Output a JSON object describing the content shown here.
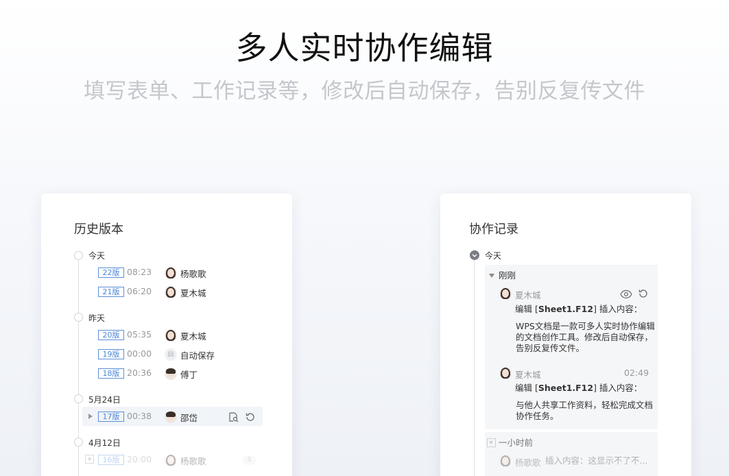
{
  "hero": {
    "title": "多人实时协作编辑",
    "subtitle": "填写表单、工作记录等，修改后自动保存，告别反复传文件"
  },
  "history": {
    "title": "历史版本",
    "days": [
      {
        "label": "今天",
        "entries": [
          {
            "version": "22版",
            "time": "08:23",
            "user": "杨歌歌",
            "avatar": "female"
          },
          {
            "version": "21版",
            "time": "06:20",
            "user": "夏木城",
            "avatar": "female"
          }
        ]
      },
      {
        "label": "昨天",
        "entries": [
          {
            "version": "20版",
            "time": "05:35",
            "user": "夏木城",
            "avatar": "female"
          },
          {
            "version": "19版",
            "time": "00:00",
            "user": "自动保存",
            "avatar": "autosave"
          },
          {
            "version": "18版",
            "time": "20:36",
            "user": "傅丁",
            "avatar": "male"
          }
        ]
      },
      {
        "label": "5月24日",
        "entries": [
          {
            "version": "17版",
            "time": "00:38",
            "user": "邵岱",
            "avatar": "male",
            "highlighted": true
          }
        ]
      },
      {
        "label": "4月12日",
        "entries": [
          {
            "version": "16版",
            "time": "20:00",
            "user": "杨歌歌",
            "avatar": "female",
            "count": "3"
          }
        ]
      }
    ]
  },
  "collab": {
    "title": "协作记录",
    "day_label": "今天",
    "groups": [
      {
        "label": "刚刚",
        "records": [
          {
            "user": "夏木城",
            "time": "",
            "action_prefix": "编辑 [",
            "cell": "Sheet1.F12",
            "action_suffix": "] 插入内容：",
            "content_lines": [
              "WPS文档是一款可多人实时协作编辑",
              "的文档创作工具。修改后自动保存，",
              "告别反复传文件。"
            ]
          },
          {
            "user": "夏木城",
            "time": "02:49",
            "action_prefix": "编辑 [",
            "cell": "Sheet1.F12",
            "action_suffix": "] 插入内容：",
            "content_lines": [
              "与他人共享工作资料，轻松完成文档",
              "协作任务。"
            ]
          }
        ]
      },
      {
        "label": "一小时前",
        "records": [
          {
            "user": "杨歌歌",
            "summary": "插入内容：这显示不了不..."
          }
        ]
      }
    ]
  },
  "colors": {
    "accent_blue": "#4a86d6",
    "title_text": "#111111",
    "subtitle_text": "#c4c7cc",
    "panel_bg": "#f5f6f8"
  }
}
